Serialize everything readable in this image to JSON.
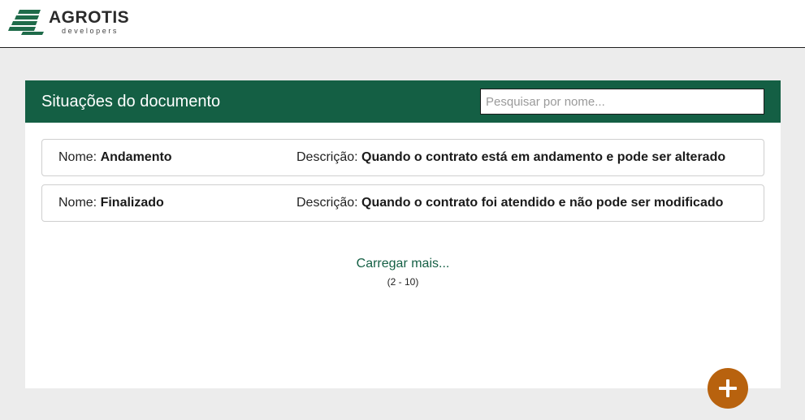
{
  "brand": {
    "name": "AGROTIS",
    "subtitle": "developers",
    "color": "#1f6b4a"
  },
  "header": {
    "title": "Situações do documento",
    "search_placeholder": "Pesquisar por nome...",
    "search_value": "",
    "bg_color": "#145f44"
  },
  "rows": [
    {
      "name_label": "Nome:",
      "name": "Andamento",
      "desc_label": "Descrição:",
      "desc": "Quando o contrato está em andamento e pode ser alterado"
    },
    {
      "name_label": "Nome:",
      "name": "Finalizado",
      "desc_label": "Descrição:",
      "desc": "Quando o contrato foi atendido e não pode ser modificado"
    }
  ],
  "pagination": {
    "load_more": "Carregar mais...",
    "range": "(2 - 10)"
  },
  "fab": {
    "icon": "plus-icon",
    "color": "#b8620e"
  }
}
